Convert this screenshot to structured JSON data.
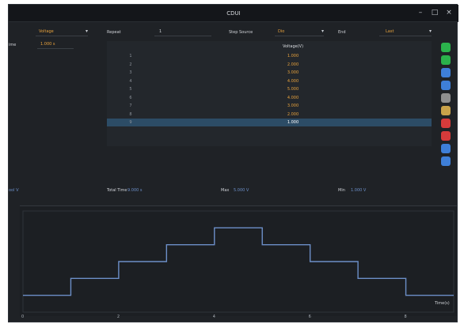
{
  "window": {
    "title": "CDUI"
  },
  "controls": {
    "mode_value": "Voltage",
    "repeat_label": "Repeat",
    "repeat_value": "1",
    "step_source_label": "Step Source",
    "step_source_value": "Dio",
    "end_label": "End",
    "end_value": "Last",
    "left_cut_label": "ime",
    "time_value": "1.000 s"
  },
  "table": {
    "header": "Voltage(V)",
    "rows": [
      {
        "idx": "1",
        "value": "1.000"
      },
      {
        "idx": "2",
        "value": "2.000"
      },
      {
        "idx": "3",
        "value": "3.000"
      },
      {
        "idx": "4",
        "value": "4.000"
      },
      {
        "idx": "5",
        "value": "5.000"
      },
      {
        "idx": "6",
        "value": "4.000"
      },
      {
        "idx": "7",
        "value": "3.000"
      },
      {
        "idx": "8",
        "value": "2.000"
      },
      {
        "idx": "9",
        "value": "1.000"
      }
    ],
    "selected_index": 8
  },
  "toolbar": [
    {
      "icon": "add-icon",
      "color": "#2bb24c"
    },
    {
      "icon": "list-icon",
      "color": "#2bb24c"
    },
    {
      "icon": "arrow-up-icon",
      "color": "#3e7fd8"
    },
    {
      "icon": "arrow-down-icon",
      "color": "#3e7fd8"
    },
    {
      "icon": "copy-icon",
      "color": "#8f8f8f"
    },
    {
      "icon": "paste-icon",
      "color": "#c9a24a"
    },
    {
      "icon": "delete-icon",
      "color": "#d63b3b"
    },
    {
      "icon": "clear-icon",
      "color": "#d63b3b"
    },
    {
      "icon": "import-icon",
      "color": "#3e7fd8"
    },
    {
      "icon": "export-icon",
      "color": "#3e7fd8"
    }
  ],
  "stats": {
    "left_value": "ool V",
    "total_label": "Total Time",
    "total_value": "9.000 s",
    "max_label": "Max",
    "max_value": "5.000 V",
    "min_label": "Min",
    "min_value": "1.000 V"
  },
  "chart_data": {
    "type": "line",
    "x_ticks": [
      "0",
      "2",
      "4",
      "6",
      "8"
    ],
    "xlabel": "Time(s)",
    "step": true,
    "x": [
      0,
      1,
      2,
      3,
      4,
      5,
      6,
      7,
      8,
      9
    ],
    "values": [
      1,
      2,
      3,
      4,
      5,
      4,
      3,
      2,
      1,
      1
    ],
    "xlim": [
      0,
      9
    ],
    "ylim": [
      0,
      6
    ],
    "line_color": "#6c8fc8"
  }
}
